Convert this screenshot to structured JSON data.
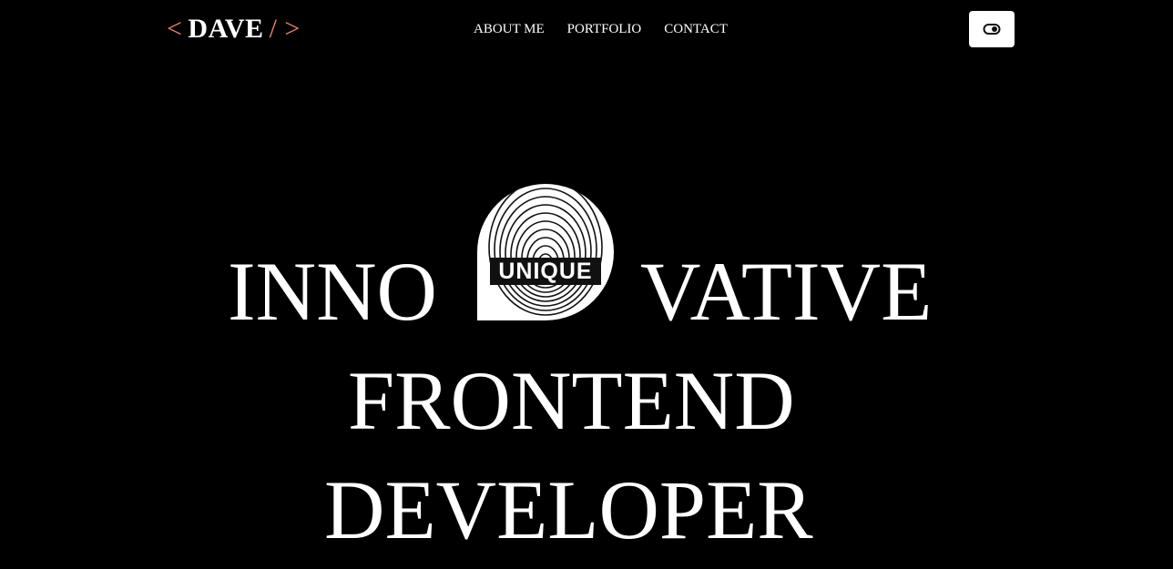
{
  "header": {
    "logo": {
      "open_bracket": "<",
      "name": "DAVE",
      "close_bracket": "/ >"
    },
    "nav": [
      {
        "label": "ABOUT ME"
      },
      {
        "label": "PORTFOLIO"
      },
      {
        "label": "CONTACT"
      }
    ],
    "theme_toggle_icon": "toggle-icon"
  },
  "hero": {
    "line1_start": "INNO",
    "line1_end": "VATIVE",
    "line2": "FRONTEND",
    "line3": "DEVELOPER",
    "badge_text": "UNIQUE",
    "badge_icon": "fingerprint-icon"
  },
  "colors": {
    "background": "#000000",
    "text": "#ffffff",
    "accent": "#e8826a"
  }
}
